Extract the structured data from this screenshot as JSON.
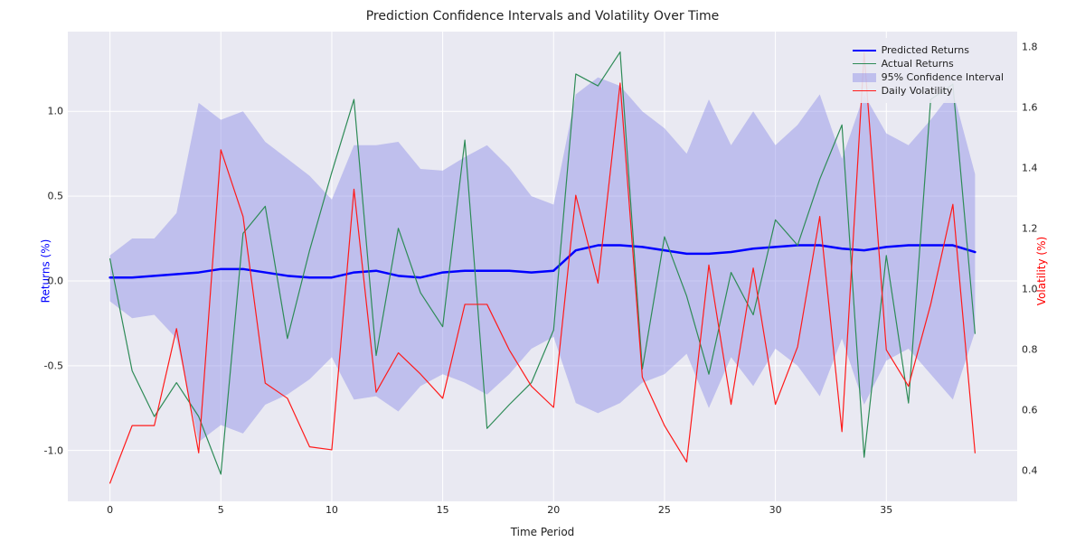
{
  "title": "Prediction Confidence Intervals and Volatility Over Time",
  "xlabel": "Time Period",
  "ylabel_left": "Returns (%)",
  "ylabel_right": "Volatility (%)",
  "legend": {
    "predicted": "Predicted Returns",
    "actual": "Actual Returns",
    "ci": "95% Confidence Interval",
    "volatility": "Daily Volatility"
  },
  "colors": {
    "predicted": "#0000ff",
    "actual": "#2e8b57",
    "ci": "#8c8ce6",
    "volatility": "#ff1a1a",
    "plot_bg": "#e9e9f2",
    "grid": "#ffffff"
  },
  "axes": {
    "x_ticks": [
      0,
      5,
      10,
      15,
      20,
      25,
      30,
      35
    ],
    "yl_ticks": [
      -1.0,
      -0.5,
      0.0,
      0.5,
      1.0
    ],
    "yr_ticks": [
      0.4,
      0.6,
      0.8,
      1.0,
      1.2,
      1.4,
      1.6,
      1.8
    ],
    "x_range": [
      -1.9,
      40.9
    ],
    "yl_range": [
      -1.3,
      1.47
    ],
    "yr_range": [
      0.3,
      1.85
    ]
  },
  "chart_data": {
    "type": "line",
    "x": [
      0,
      1,
      2,
      3,
      4,
      5,
      6,
      7,
      8,
      9,
      10,
      11,
      12,
      13,
      14,
      15,
      16,
      17,
      18,
      19,
      20,
      21,
      22,
      23,
      24,
      25,
      26,
      27,
      28,
      29,
      30,
      31,
      32,
      33,
      34,
      35,
      36,
      37,
      38,
      39
    ],
    "series": [
      {
        "name": "Predicted Returns",
        "axis": "left",
        "values": [
          0.02,
          0.02,
          0.03,
          0.04,
          0.05,
          0.07,
          0.07,
          0.05,
          0.03,
          0.02,
          0.02,
          0.05,
          0.06,
          0.03,
          0.02,
          0.05,
          0.06,
          0.06,
          0.06,
          0.05,
          0.06,
          0.18,
          0.21,
          0.21,
          0.2,
          0.18,
          0.16,
          0.16,
          0.17,
          0.19,
          0.2,
          0.21,
          0.21,
          0.19,
          0.18,
          0.2,
          0.21,
          0.21,
          0.21,
          0.17
        ],
        "style": {
          "color": "#0000ff",
          "width": 2.5
        }
      },
      {
        "name": "Actual Returns",
        "axis": "left",
        "values": [
          0.13,
          -0.53,
          -0.8,
          -0.6,
          -0.8,
          -1.14,
          0.28,
          0.44,
          -0.34,
          0.18,
          0.64,
          1.07,
          -0.44,
          0.31,
          -0.07,
          -0.27,
          0.83,
          -0.87,
          -0.73,
          -0.6,
          -0.29,
          1.22,
          1.15,
          1.35,
          -0.52,
          0.26,
          -0.09,
          -0.55,
          0.05,
          -0.2,
          0.36,
          0.21,
          0.6,
          0.92,
          -1.04,
          0.15,
          -0.72,
          1.07,
          1.16,
          -0.31
        ],
        "style": {
          "color": "#2e8b57",
          "width": 1.2
        }
      },
      {
        "name": "Daily Volatility",
        "axis": "right",
        "values": [
          0.36,
          0.55,
          0.55,
          0.87,
          0.46,
          1.46,
          1.24,
          0.69,
          0.64,
          0.48,
          0.47,
          1.33,
          0.66,
          0.79,
          0.72,
          0.64,
          0.95,
          0.95,
          0.8,
          0.68,
          0.61,
          1.31,
          1.02,
          1.68,
          0.71,
          0.55,
          0.43,
          1.08,
          0.62,
          1.07,
          0.62,
          0.81,
          1.24,
          0.53,
          1.78,
          0.8,
          0.68,
          0.95,
          1.28,
          0.46
        ],
        "style": {
          "color": "#ff1a1a",
          "width": 1.2
        }
      }
    ],
    "confidence_band": {
      "name": "95% Confidence Interval",
      "axis": "left",
      "lower": [
        -0.12,
        -0.22,
        -0.2,
        -0.34,
        -0.95,
        -0.85,
        -0.9,
        -0.73,
        -0.67,
        -0.58,
        -0.45,
        -0.7,
        -0.68,
        -0.77,
        -0.62,
        -0.55,
        -0.6,
        -0.67,
        -0.55,
        -0.4,
        -0.33,
        -0.72,
        -0.78,
        -0.72,
        -0.6,
        -0.55,
        -0.43,
        -0.75,
        -0.45,
        -0.62,
        -0.4,
        -0.5,
        -0.68,
        -0.34,
        -0.73,
        -0.47,
        -0.4,
        -0.55,
        -0.7,
        -0.3
      ],
      "upper": [
        0.15,
        0.25,
        0.25,
        0.4,
        1.05,
        0.95,
        1.0,
        0.82,
        0.72,
        0.62,
        0.48,
        0.8,
        0.8,
        0.82,
        0.66,
        0.65,
        0.73,
        0.8,
        0.67,
        0.5,
        0.45,
        1.1,
        1.2,
        1.15,
        1.0,
        0.9,
        0.75,
        1.07,
        0.8,
        1.0,
        0.8,
        0.92,
        1.1,
        0.72,
        1.1,
        0.87,
        0.8,
        0.95,
        1.12,
        0.63
      ],
      "style": {
        "fill": "#8c8ce6",
        "opacity": 0.45
      }
    },
    "title": "Prediction Confidence Intervals and Volatility Over Time",
    "xlabel": "Time Period",
    "ylabel": "Returns (%)",
    "ylim": [
      -1.3,
      1.47
    ]
  }
}
